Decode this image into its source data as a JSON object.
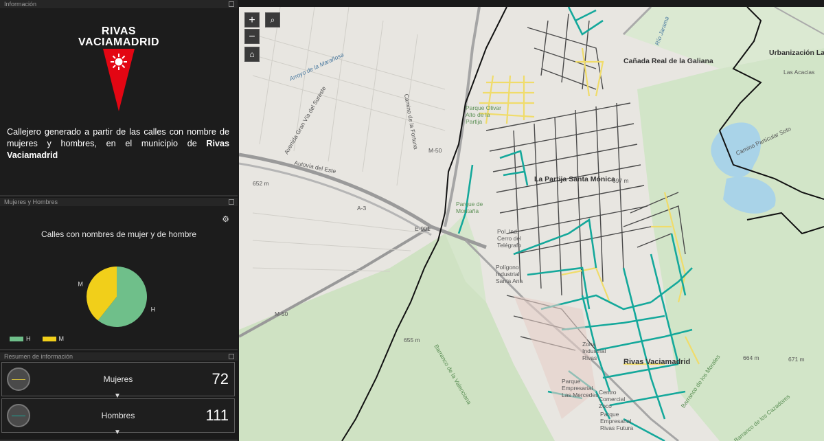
{
  "panels": {
    "info": {
      "title": "Información"
    },
    "chart": {
      "title": "Mujeres y Hombres"
    },
    "summary": {
      "title": "Resumen de información"
    }
  },
  "logo": {
    "line1": "RIVAS",
    "line2": "VACIAMADRID"
  },
  "description": {
    "text": "Callejero generado a partir de las calles con nombre de mujeres y hombres, en el municipio de ",
    "bold": "Rivas Vaciamadrid"
  },
  "chart_data": {
    "type": "pie",
    "title": "Calles con nombres de mujer y de hombre",
    "categories": [
      "H",
      "M"
    ],
    "values": [
      111,
      72
    ],
    "colors": [
      "#6fbf8a",
      "#f1cf1a"
    ],
    "legend": [
      {
        "label": "H",
        "color": "#6fbf8a"
      },
      {
        "label": "M",
        "color": "#f1cf1a"
      }
    ],
    "legend_position": "bottom-left"
  },
  "summary": [
    {
      "label": "Mujeres",
      "value": "72",
      "color": "#c8b43c"
    },
    {
      "label": "Hombres",
      "value": "111",
      "color": "#1aa89a"
    }
  ],
  "map": {
    "controls": {
      "zoom_in": "+",
      "zoom_out": "−",
      "search": "search-icon",
      "home": "home-icon"
    },
    "labels": {
      "urbanizacion": "Urbanización Las Acacias",
      "las_acacias": "Las Acacias",
      "canada": "Cañada Real de la Galiana",
      "la_partija": "La Partija Santa Mónica",
      "rivas": "Rivas Vaciamadrid",
      "arroyo_maranosa": "Arroyo de la Marañosa",
      "autovia": "Autovía del Este",
      "m50_a": "M-50",
      "m50_b": "M-50",
      "a3": "A-3",
      "e901": "E-901",
      "e652": "652 m",
      "e697": "697 m",
      "e655": "655 m",
      "e664": "664 m",
      "e671": "671 m",
      "barranco_valenciana": "Barranco de la Valenciana",
      "barranco_morales": "Barranco de los Morales",
      "barranco_cazadores": "Barranco de los Cazadores",
      "parque_oliver": "Parque Olivar Alto de la Partija",
      "parque_montaña": "Parque de Montaña",
      "cerro_telegrafo": "Pol. Ind. Cerro del Telégrafo",
      "poligono_santa_ana": "Polígono Industrial Santa Ana",
      "zona_industrial": "Zona Industrial Rivas",
      "parque_empresarial": "Parque Empresarial Las Mercedes",
      "centro_comercial": "Centro Comercial Zoco",
      "parque_rivas_futura": "Parque Empresarial Rivas Futura",
      "avenida_gran_via": "Avenida Gran Vía del Sureste",
      "camino_fortuna": "Camino de la Fortuna",
      "rio_jarama": "Río Jarama",
      "camino_particular": "Camino Particular Soto"
    }
  }
}
